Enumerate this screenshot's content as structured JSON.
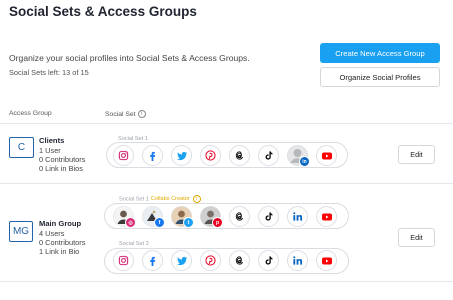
{
  "page": {
    "title": "Social Sets & Access Groups",
    "intro": "Organize your social profiles into Social Sets & Access Groups.",
    "sets_left": "Social Sets left: 13 of 15"
  },
  "actions": {
    "create_label": "Create New Access Group",
    "organize_label": "Organize Social Profiles"
  },
  "table": {
    "col_access_group": "Access Group",
    "col_social_set": "Social Set"
  },
  "groups": [
    {
      "badge": "C",
      "name": "Clients",
      "users": "1 User",
      "contributors": "0 Contributors",
      "link_in_bio": "0 Link in Bios",
      "edit_label": "Edit",
      "sets": [
        {
          "label": "Social Set 1",
          "profiles": [
            "instagram-icon",
            "facebook-icon",
            "twitter-icon",
            "pinterest-icon",
            "threads-icon",
            "tiktok-icon",
            "linkedin-profile-avatar",
            "youtube-icon"
          ]
        }
      ]
    },
    {
      "badge": "MG",
      "name": "Main Group",
      "users": "4 Users",
      "contributors": "0 Contributors",
      "link_in_bio": "1 Link in Bio",
      "edit_label": "Edit",
      "sets": [
        {
          "label": "Social Set 1",
          "collab": "Collabs Creator",
          "profiles": [
            "instagram-profile-avatar",
            "facebook-profile-avatar",
            "twitter-profile-avatar",
            "pinterest-profile-avatar",
            "threads-icon",
            "tiktok-icon",
            "linkedin-icon",
            "youtube-icon"
          ]
        },
        {
          "label": "Social Set 2",
          "profiles": [
            "instagram-icon",
            "facebook-icon",
            "twitter-icon",
            "pinterest-icon",
            "threads-icon",
            "tiktok-icon",
            "linkedin-icon",
            "youtube-icon"
          ]
        }
      ]
    }
  ],
  "colors": {
    "primary_button": "#1aa0f0",
    "group_badge": "#2563a8",
    "instagram": "#d62976",
    "facebook": "#1877f2",
    "twitter": "#1da1f2",
    "pinterest": "#e60023",
    "linkedin": "#0a66c2",
    "youtube": "#ff0000",
    "collab": "#e0a800"
  }
}
